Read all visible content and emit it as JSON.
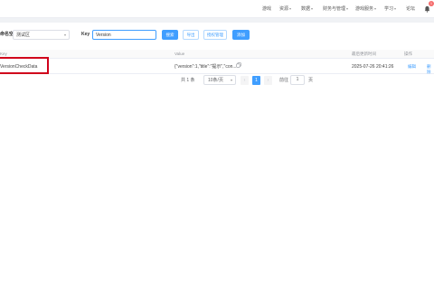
{
  "topnav": {
    "items": [
      {
        "label": "游戏",
        "has_caret": false
      },
      {
        "label": "资源",
        "has_caret": true
      },
      {
        "label": "数据",
        "has_caret": true
      },
      {
        "label": "财务与管理",
        "has_caret": true
      },
      {
        "label": "游戏服务",
        "has_caret": true
      },
      {
        "label": "学习",
        "has_caret": true
      },
      {
        "label": "论坛",
        "has_caret": false
      }
    ],
    "notification_count": "1",
    "caret": "▾"
  },
  "filters": {
    "namespace_label": "命名空间",
    "namespace_value": "测试区",
    "key_label": "Key",
    "key_value": "Version"
  },
  "toolbar": {
    "search": "搜索",
    "export": "导出",
    "permission": "授权管理",
    "add": "添加"
  },
  "table": {
    "columns": {
      "key": "Key",
      "value": "Value",
      "updated": "最后更新时间",
      "actions": "操作"
    },
    "rows": [
      {
        "key": "VersionCheckData",
        "value": "{\"version\":1,\"title\":\"提示\",\"con...",
        "updated": "2025-07-26 20:41:26",
        "edit": "编辑",
        "delete": "删除"
      }
    ]
  },
  "pagination": {
    "total": "共 1 条",
    "page_size": "10条/页",
    "prev": "‹",
    "current": "1",
    "next": "›",
    "goto_label": "前往",
    "goto_value": "1",
    "page_unit": "页"
  },
  "colors": {
    "primary": "#409eff",
    "highlight": "#d0021b",
    "badge": "#f56c6c"
  }
}
